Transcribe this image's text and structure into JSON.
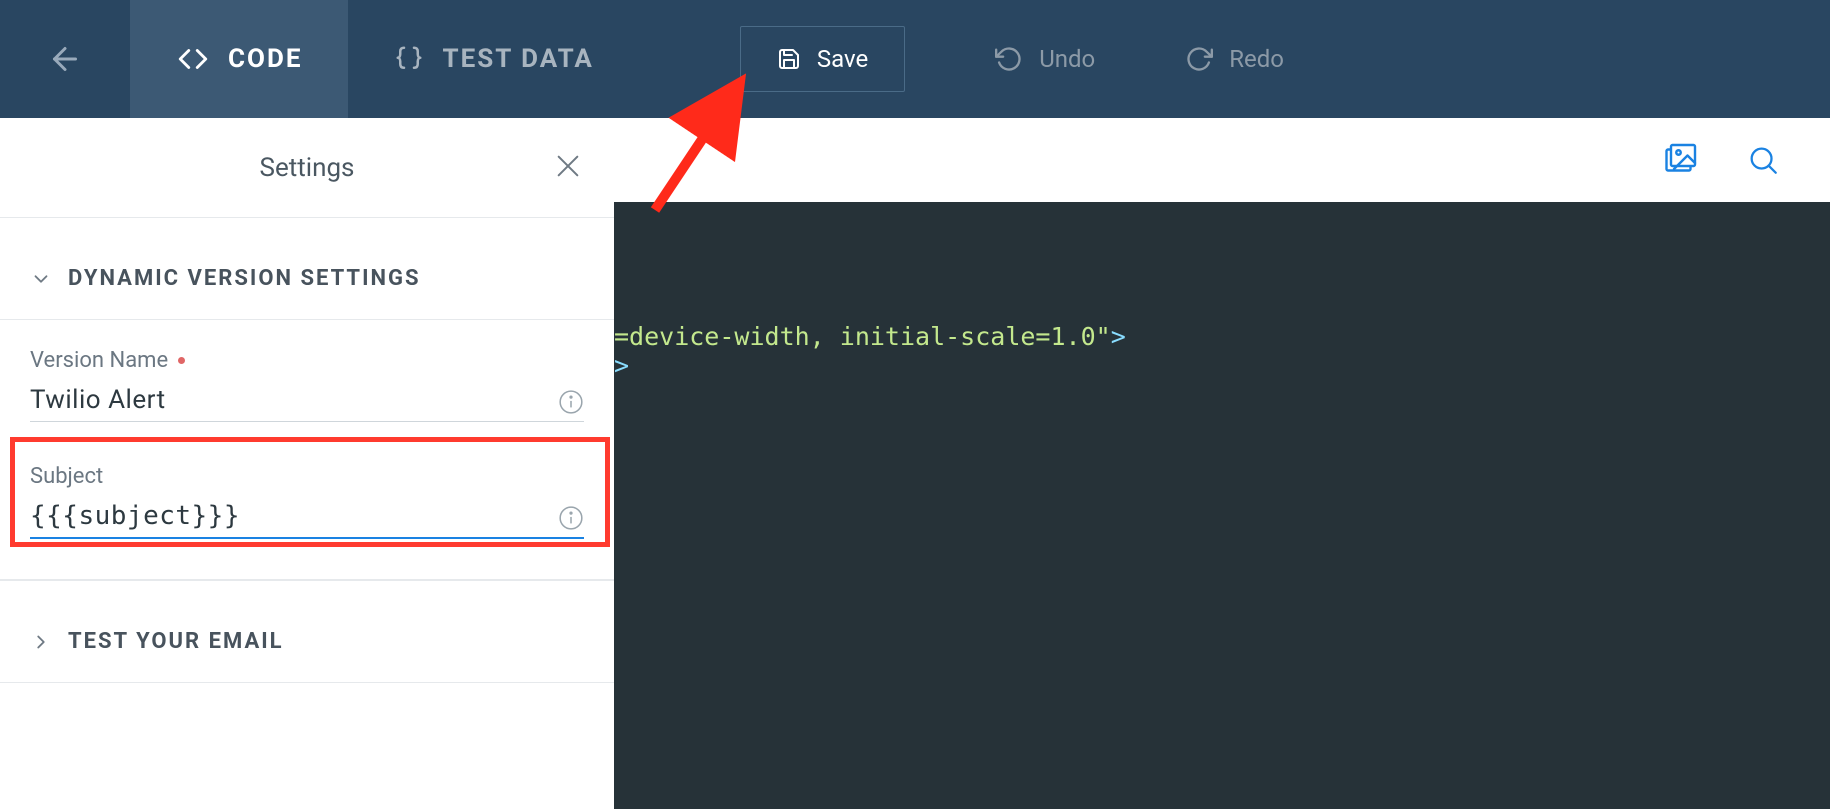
{
  "topbar": {
    "tabs": {
      "code": "CODE",
      "testdata": "TEST DATA"
    },
    "save": "Save",
    "undo": "Undo",
    "redo": "Redo"
  },
  "panel": {
    "title": "Settings",
    "section_dynamic": "DYNAMIC VERSION SETTINGS",
    "section_test": "TEST YOUR EMAIL",
    "version_label": "Version Name",
    "version_value": "Twilio Alert",
    "subject_label": "Subject",
    "subject_value": "{{{subject}}}"
  },
  "editor": {
    "line1_attr": "=device-width, initial-scale=1.0\"",
    "line1_close": ">",
    "line2_close": ">"
  }
}
